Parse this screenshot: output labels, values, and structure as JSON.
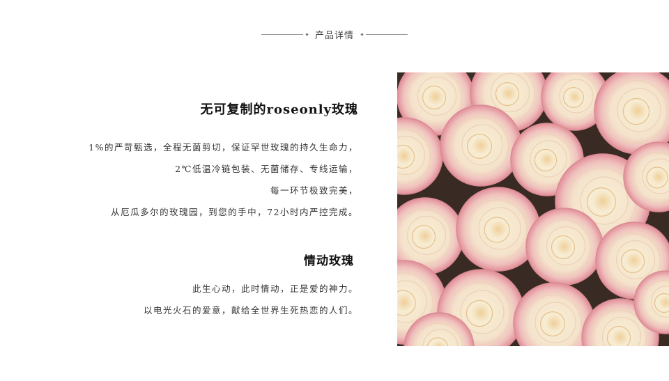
{
  "header": {
    "title": "产品详情"
  },
  "section1": {
    "title": "无可复制的roseonly玫瑰",
    "lines": [
      "1%的严苛甄选，全程无菌剪切，保证罕世玫瑰的持久生命力，",
      "2℃低温冷链包装、无菌储存、专线运输，",
      "每一环节极致完美，",
      "从厄瓜多尔的玫瑰园，到您的手中，72小时内严控完成。"
    ]
  },
  "section2": {
    "title": "情动玫瑰",
    "lines": [
      "此生心动，此时情动，正是爱的神力。",
      "以电光火石的爱意，献给全世界生死热恋的人们。"
    ]
  },
  "photo": {
    "icon": "rose-bouquet-photo",
    "colors": {
      "petal_center": "#f7ecd2",
      "petal_mid": "#f3dcc4",
      "petal_edge": "#e8a3a9",
      "shadow": "#3a2a24"
    }
  }
}
